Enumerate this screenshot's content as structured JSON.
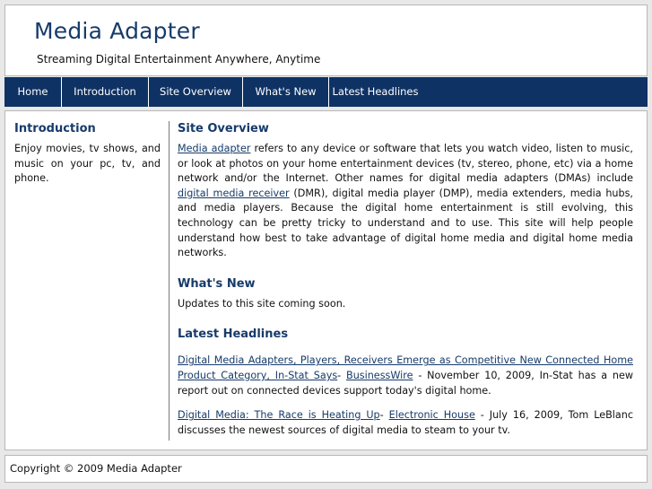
{
  "header": {
    "title": "Media Adapter",
    "tagline": "Streaming Digital Entertainment Anywhere, Anytime"
  },
  "nav": {
    "items": [
      "Home",
      "Introduction",
      "Site Overview",
      "What's New",
      "Latest Headlines"
    ]
  },
  "sidebar": {
    "heading": "Introduction",
    "text": "Enjoy movies, tv shows, and music on your pc, tv, and phone."
  },
  "overview": {
    "heading": "Site Overview",
    "link1": "Media adapter",
    "text1": " refers to any device or software that lets you watch video, listen to music, or look at photos on your home entertainment devices (tv, stereo, phone, etc) via a home network and/or the Internet. Other names for digital media adapters (DMAs) include ",
    "link2": "digital media receiver",
    "text2": " (DMR), digital media player (DMP), media extenders, media hubs, and media players. Because the digital home entertainment is still evolving, this technology can be pretty tricky to understand and to use. This site will help people understand how best to take advantage of digital home media and digital home media networks."
  },
  "whats_new": {
    "heading": "What's New",
    "text": "Updates to this site coming soon."
  },
  "headlines": {
    "heading": "Latest Headlines",
    "items": [
      {
        "title": "Digital Media Adapters, Players, Receivers Emerge as Competitive New Connected Home Product Category, In-Stat Says",
        "sep": "- ",
        "source": "BusinessWire",
        "desc": " - November 10, 2009, In-Stat has a new report out on connected devices support today's digital home."
      },
      {
        "title": "Digital Media: The Race is Heating Up",
        "sep": "- ",
        "source": "Electronic House",
        "desc": " - July 16, 2009, Tom LeBlanc discusses the newest sources of digital media to steam to your tv."
      }
    ]
  },
  "footer": {
    "text": "Copyright © 2009 Media Adapter"
  }
}
